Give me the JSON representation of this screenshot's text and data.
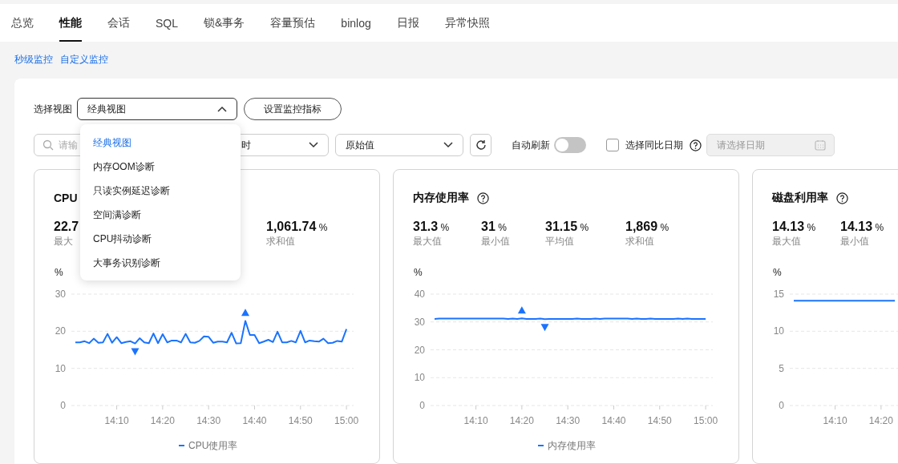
{
  "tabs": [
    {
      "label": "总览",
      "selected": false
    },
    {
      "label": "性能",
      "selected": true
    },
    {
      "label": "会话",
      "selected": false
    },
    {
      "label": "SQL",
      "selected": false
    },
    {
      "label": "锁&事务",
      "selected": false
    },
    {
      "label": "容量预估",
      "selected": false
    },
    {
      "label": "binlog",
      "selected": false
    },
    {
      "label": "日报",
      "selected": false
    },
    {
      "label": "异常快照",
      "selected": false
    }
  ],
  "sub_links": [
    "秒级监控",
    "自定义监控"
  ],
  "toolbar": {
    "view_label": "选择视图",
    "view_select": {
      "value": "经典视图",
      "expanded": true
    },
    "metrics_button": "设置监控指标",
    "search": {
      "placeholder": "请输"
    },
    "time_select": {
      "value": "时"
    },
    "value_select": {
      "value": "原始值"
    },
    "auto_refresh": {
      "label": "自动刷新",
      "on": false
    },
    "compare": {
      "label": "选择同比日期",
      "checked": false
    },
    "date": {
      "placeholder": "请选择日期",
      "disabled": true
    }
  },
  "view_menu": [
    {
      "label": "经典视图",
      "selected": true
    },
    {
      "label": "内存OOM诊断",
      "selected": false
    },
    {
      "label": "只读实例延迟诊断",
      "selected": false
    },
    {
      "label": "空间满诊断",
      "selected": false
    },
    {
      "label": "CPU抖动诊断",
      "selected": false
    },
    {
      "label": "大事务识别诊断",
      "selected": false
    }
  ],
  "cards": [
    {
      "title": "CPU",
      "help": false,
      "stats": [
        {
          "kind": "max",
          "value": "22.7",
          "label": "最大"
        },
        {
          "kind": "sum",
          "value": "1,061.74",
          "unit": "%",
          "label": "求和值"
        }
      ],
      "chart_data": {
        "type": "line",
        "ylabel": "%",
        "grid": true,
        "ylim": [
          0,
          30
        ],
        "yticks": [
          0,
          10,
          20,
          30
        ],
        "categories": [
          null,
          null,
          null,
          null,
          null,
          null,
          null,
          null,
          null,
          "14:10",
          null,
          null,
          null,
          null,
          null,
          null,
          null,
          null,
          null,
          "14:20",
          null,
          null,
          null,
          null,
          null,
          null,
          null,
          null,
          null,
          "14:30",
          null,
          null,
          null,
          null,
          null,
          null,
          null,
          null,
          null,
          "14:40",
          null,
          null,
          null,
          null,
          null,
          null,
          null,
          null,
          null,
          "14:50",
          null,
          null,
          null,
          null,
          null,
          null,
          null,
          null,
          null,
          "15:00"
        ],
        "series": [
          {
            "name": "CPU使用率",
            "color": "#1a73ff",
            "values": [
              17,
              17,
              17.3,
              16.8,
              18,
              16.9,
              17,
              19.3,
              16.9,
              18.4,
              16.8,
              17.1,
              17.3,
              16.7,
              18.1,
              17,
              16.8,
              19.4,
              16.8,
              19.2,
              17,
              17.5,
              17.5,
              17,
              19.3,
              17,
              16.9,
              17.4,
              18.6,
              18.5,
              16.9,
              17.2,
              17.2,
              17,
              19.6,
              16.7,
              16.8,
              22.8,
              19,
              19,
              16.8,
              17.2,
              17.7,
              17.1,
              19.9,
              17,
              17,
              17.4,
              17,
              20.1,
              17,
              17.5,
              17.3,
              17.2,
              18,
              16.8,
              16.9,
              17.4,
              17.2,
              20.6
            ]
          }
        ]
      }
    },
    {
      "title": "内存使用率",
      "help": true,
      "stats": [
        {
          "kind": "max",
          "value": "31.3",
          "unit": "%",
          "label": "最大值"
        },
        {
          "kind": "min",
          "value": "31",
          "unit": "%",
          "label": "最小值"
        },
        {
          "kind": "avg",
          "value": "31.15",
          "unit": "%",
          "label": "平均值"
        },
        {
          "kind": "sum",
          "value": "1,869",
          "unit": "%",
          "label": "求和值"
        }
      ],
      "chart_data": {
        "type": "line",
        "ylabel": "%",
        "grid": true,
        "ylim": [
          0,
          40
        ],
        "yticks": [
          0,
          10,
          20,
          30,
          40
        ],
        "categories": [
          null,
          null,
          null,
          null,
          null,
          null,
          null,
          null,
          null,
          "14:10",
          null,
          null,
          null,
          null,
          null,
          null,
          null,
          null,
          null,
          "14:20",
          null,
          null,
          null,
          null,
          null,
          null,
          null,
          null,
          null,
          "14:30",
          null,
          null,
          null,
          null,
          null,
          null,
          null,
          null,
          null,
          "14:40",
          null,
          null,
          null,
          null,
          null,
          null,
          null,
          null,
          null,
          "14:50",
          null,
          null,
          null,
          null,
          null,
          null,
          null,
          null,
          null,
          "15:00"
        ],
        "series": [
          {
            "name": "内存使用率",
            "color": "#1a73ff",
            "values": [
              31.1,
              31.2,
              31.2,
              31.2,
              31.2,
              31.2,
              31.2,
              31.2,
              31.2,
              31.2,
              31.2,
              31.2,
              31.2,
              31.2,
              31.2,
              31.2,
              31.1,
              31.2,
              31.1,
              31.3,
              31.1,
              31.1,
              31.1,
              31.2,
              31,
              31.1,
              31.1,
              31.1,
              31.1,
              31.1,
              31.1,
              31.2,
              31.1,
              31.1,
              31.1,
              31.2,
              31.1,
              31.2,
              31.2,
              31.2,
              31.2,
              31.2,
              31.2,
              31.1,
              31.2,
              31.1,
              31.1,
              31.2,
              31.1,
              31.1,
              31.1,
              31.1,
              31.1,
              31.2,
              31.1,
              31.2,
              31.1,
              31.1,
              31.1,
              31.1
            ]
          }
        ]
      }
    },
    {
      "title": "磁盘利用率",
      "help": true,
      "stats": [
        {
          "kind": "max",
          "value": "14.13",
          "unit": "%",
          "label": "最大值"
        },
        {
          "kind": "min",
          "value": "14.13",
          "unit": "%",
          "label": "最小值"
        }
      ],
      "chart_data": {
        "type": "line",
        "ylabel": "%",
        "grid": true,
        "ylim": [
          0,
          15
        ],
        "yticks": [
          0,
          5,
          10,
          15
        ],
        "categories": [
          null,
          null,
          null,
          null,
          null,
          null,
          null,
          null,
          null,
          "14:10",
          null,
          null,
          null,
          null,
          null,
          null,
          null,
          null,
          null,
          "14:20",
          null,
          null,
          null
        ],
        "series": [
          {
            "color": "#1a73ff",
            "values": [
              14.1,
              14.1,
              14.1,
              14.1,
              14.1,
              14.1,
              14.1,
              14.1,
              14.1,
              14.1,
              14.1,
              14.1,
              14.1,
              14.1,
              14.1,
              14.1,
              14.1,
              14.1,
              14.1,
              14.1,
              14.1,
              14.1,
              14.1
            ]
          }
        ]
      }
    }
  ]
}
